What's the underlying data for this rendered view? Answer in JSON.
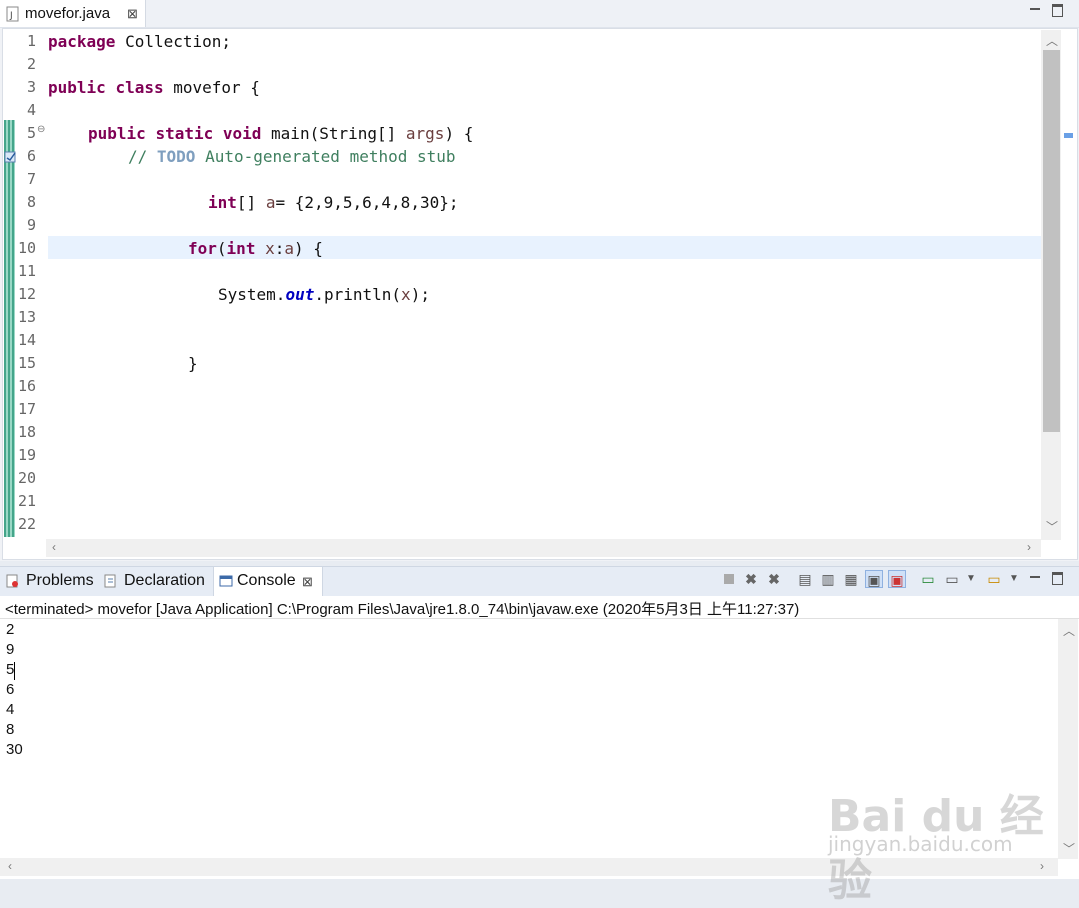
{
  "editor": {
    "tab_title": "movefor.java",
    "tab_close": "⊠",
    "line_numbers": [
      "1",
      "2",
      "3",
      "4",
      "5",
      "6",
      "7",
      "8",
      "9",
      "10",
      "11",
      "12",
      "13",
      "14",
      "15",
      "16",
      "17",
      "18",
      "19",
      "20",
      "21",
      "22"
    ],
    "code": {
      "l1_kw": "package",
      "l1_rest": " Collection;",
      "l3_kw1": "public",
      "l3_kw2": "class",
      "l3_rest": " movefor {",
      "l5_kw1": "public",
      "l5_kw2": "static",
      "l5_kw3": "void",
      "l5_rest1": " main(String[] ",
      "l5_arg": "args",
      "l5_rest2": ") {",
      "l6_cm1": "// ",
      "l6_todo": "TODO",
      "l6_cm2": " Auto-generated method stub",
      "l8_kw": "int",
      "l8_rest1": "[] ",
      "l8_var": "a",
      "l8_rest2": "= {2,9,5,6,4,8,30};",
      "l10_kw1": "for",
      "l10_p": "(",
      "l10_kw2": "int",
      "l10_sp": " ",
      "l10_var1": "x",
      "l10_colon": ":",
      "l10_var2": "a",
      "l10_rest": ") {",
      "l12_a": "System.",
      "l12_out": "out",
      "l12_b": ".println(",
      "l12_var": "x",
      "l12_c": ");",
      "l15": "}"
    }
  },
  "bottom": {
    "tabs": [
      {
        "label": "Problems"
      },
      {
        "label": "Declaration"
      },
      {
        "label": "Console"
      }
    ],
    "console_close": "⊠",
    "status": "<terminated> movefor [Java Application] C:\\Program Files\\Java\\jre1.8.0_74\\bin\\javaw.exe (2020年5月3日 上午11:27:37)",
    "output": [
      "2",
      "9",
      "5",
      "6",
      "4",
      "8",
      "30"
    ]
  },
  "watermark": {
    "logo": "Bai du 经验",
    "url": "jingyan.baidu.com"
  },
  "colors": {
    "keyword": "#7f0055",
    "comment": "#3f7f5f",
    "field": "#0000c0",
    "current_line": "#e8f2fe"
  }
}
